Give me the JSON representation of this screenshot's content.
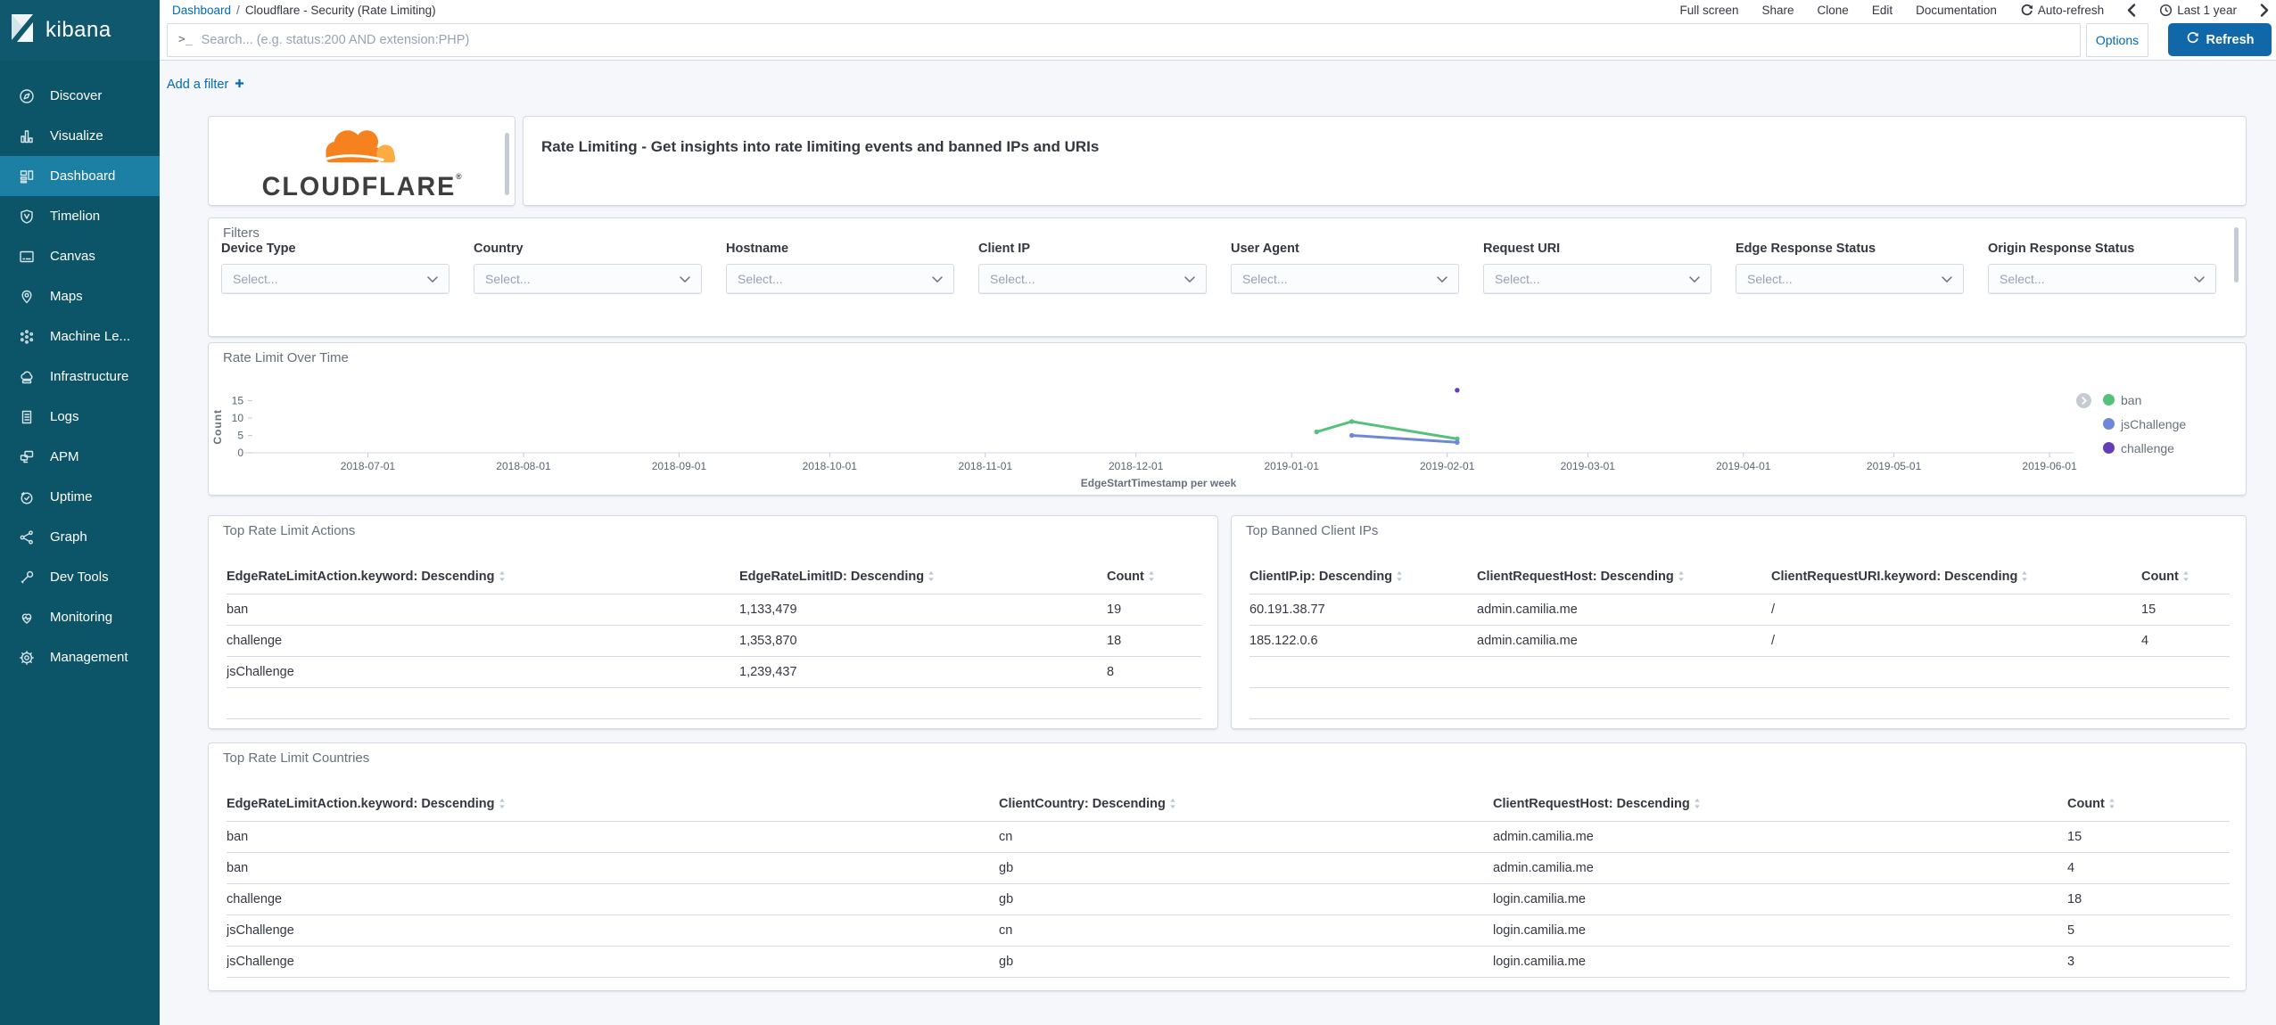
{
  "topnav": {
    "breadcrumb": {
      "link": "Dashboard",
      "separator": "/",
      "current": "Cloudflare - Security (Rate Limiting)"
    },
    "menu_items": [
      "Full screen",
      "Share",
      "Clone",
      "Edit",
      "Documentation"
    ],
    "auto_refresh": "Auto-refresh",
    "time_range": "Last 1 year"
  },
  "query_bar": {
    "prompt_symbol": ">_",
    "placeholder": "Search... (e.g. status:200 AND extension:PHP)",
    "options": "Options",
    "refresh": "Refresh"
  },
  "filter_bar": {
    "add_filter": "Add a filter"
  },
  "sidebar": {
    "product": "kibana",
    "items": [
      {
        "label": "Discover",
        "icon": "compass-icon",
        "active": false
      },
      {
        "label": "Visualize",
        "icon": "bar-chart-icon",
        "active": false
      },
      {
        "label": "Dashboard",
        "icon": "dashboard-icon",
        "active": true
      },
      {
        "label": "Timelion",
        "icon": "timelion-icon",
        "active": false
      },
      {
        "label": "Canvas",
        "icon": "canvas-icon",
        "active": false
      },
      {
        "label": "Maps",
        "icon": "map-pin-icon",
        "active": false
      },
      {
        "label": "Machine Le...",
        "icon": "machine-learning-icon",
        "active": false
      },
      {
        "label": "Infrastructure",
        "icon": "cloud-icon",
        "active": false
      },
      {
        "label": "Logs",
        "icon": "logs-icon",
        "active": false
      },
      {
        "label": "APM",
        "icon": "apm-icon",
        "active": false
      },
      {
        "label": "Uptime",
        "icon": "uptime-icon",
        "active": false
      },
      {
        "label": "Graph",
        "icon": "graph-icon",
        "active": false
      },
      {
        "label": "Dev Tools",
        "icon": "wrench-icon",
        "active": false
      },
      {
        "label": "Monitoring",
        "icon": "monitoring-icon",
        "active": false
      },
      {
        "label": "Management",
        "icon": "gear-icon",
        "active": false
      }
    ]
  },
  "cloudflare_panel": {
    "wordmark": "CLOUDFLARE",
    "registered_mark": "®"
  },
  "title_panel": {
    "text": "Rate Limiting - Get insights into rate limiting events and banned IPs and URIs"
  },
  "filters_panel": {
    "title": "Filters",
    "select_placeholder": "Select...",
    "fields": [
      "Device Type",
      "Country",
      "Hostname",
      "Client IP",
      "User Agent",
      "Request URI",
      "Edge Response Status",
      "Origin Response Status"
    ]
  },
  "chart_panel": {
    "title": "Rate Limit Over Time"
  },
  "chart_data": {
    "type": "line",
    "title": "Rate Limit Over Time",
    "xlabel": "EdgeStartTimestamp per week",
    "ylabel": "Count",
    "x_ticks": [
      "2018-07-01",
      "2018-08-01",
      "2018-09-01",
      "2018-10-01",
      "2018-11-01",
      "2018-12-01",
      "2019-01-01",
      "2019-02-01",
      "2019-03-01",
      "2019-04-01",
      "2019-05-01",
      "2019-06-01"
    ],
    "x_range": [
      "2018-06-08",
      "2019-06-04"
    ],
    "y_ticks": [
      0,
      5,
      10,
      15
    ],
    "grid": false,
    "legend_position": "right",
    "series": [
      {
        "name": "ban",
        "color": "#57c17b",
        "points": [
          [
            "2019-01-06",
            6
          ],
          [
            "2019-01-13",
            9
          ],
          [
            "2019-02-03",
            4
          ]
        ]
      },
      {
        "name": "jsChallenge",
        "color": "#6f87d8",
        "points": [
          [
            "2019-01-13",
            5
          ],
          [
            "2019-02-03",
            3
          ]
        ]
      },
      {
        "name": "challenge",
        "color": "#663db8",
        "points": [
          [
            "2019-02-03",
            18
          ]
        ]
      }
    ]
  },
  "tables": {
    "actions": {
      "title": "Top Rate Limit Actions",
      "columns": [
        "EdgeRateLimitAction.keyword: Descending",
        "EdgeRateLimitID: Descending",
        "Count"
      ],
      "rows": [
        [
          "ban",
          "1,133,479",
          "19"
        ],
        [
          "challenge",
          "1,353,870",
          "18"
        ],
        [
          "jsChallenge",
          "1,239,437",
          "8"
        ]
      ],
      "empty_rows": 1
    },
    "banned_ips": {
      "title": "Top Banned Client IPs",
      "columns": [
        "ClientIP.ip: Descending",
        "ClientRequestHost: Descending",
        "ClientRequestURI.keyword: Descending",
        "Count"
      ],
      "rows": [
        [
          "60.191.38.77",
          "admin.camilia.me",
          "/",
          "15"
        ],
        [
          "185.122.0.6",
          "admin.camilia.me",
          "/",
          "4"
        ]
      ],
      "empty_rows": 2
    },
    "countries": {
      "title": "Top Rate Limit Countries",
      "columns": [
        "EdgeRateLimitAction.keyword: Descending",
        "ClientCountry: Descending",
        "ClientRequestHost: Descending",
        "Count"
      ],
      "rows": [
        [
          "ban",
          "cn",
          "admin.camilia.me",
          "15"
        ],
        [
          "ban",
          "gb",
          "admin.camilia.me",
          "4"
        ],
        [
          "challenge",
          "gb",
          "login.camilia.me",
          "18"
        ],
        [
          "jsChallenge",
          "cn",
          "login.camilia.me",
          "5"
        ],
        [
          "jsChallenge",
          "gb",
          "login.camilia.me",
          "3"
        ]
      ],
      "empty_rows": 0
    }
  },
  "colors": {
    "accent_blue": "#006bb4",
    "sidebar": "#0c5468",
    "sidebar_active": "#1c7fa4",
    "cloudflare_orange": "#f6821f",
    "cloudflare_light_orange": "#fbad41"
  }
}
